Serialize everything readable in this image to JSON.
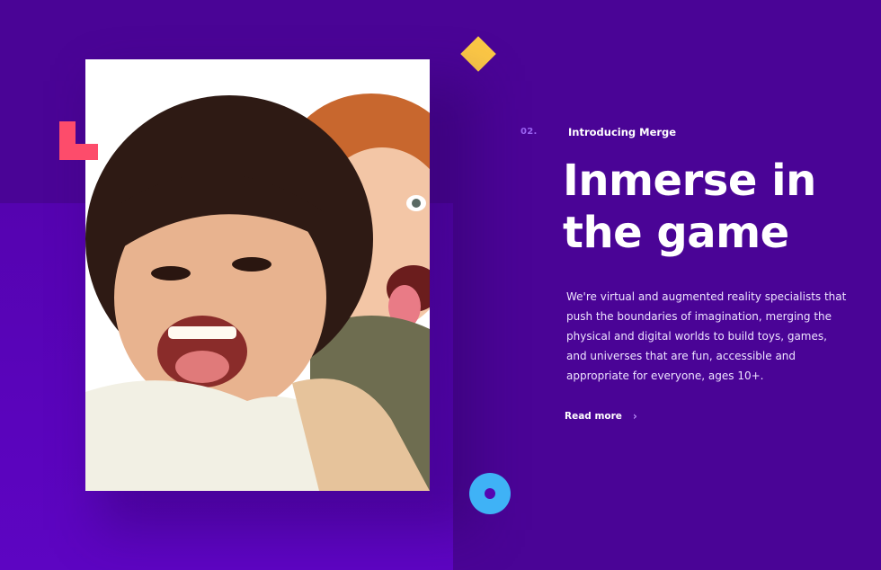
{
  "section": {
    "number": "02.",
    "eyebrow": "Introducing Merge",
    "headline": [
      "Inmerse in",
      "the game"
    ],
    "body": [
      "We're virtual and augmented reality specialists that",
      "push the boundaries of imagination, merging the",
      "physical and digital worlds to build toys, games,",
      "and universes that are fun, accessible and",
      "appropriate for everyone, ages 10+."
    ],
    "cta": {
      "label": "Read more",
      "icon": "chevron-right-icon"
    }
  },
  "photo": {
    "subject": "kids-laughing-photo"
  },
  "decorations": [
    {
      "name": "l-shape",
      "color": "#fd4c6b"
    },
    {
      "name": "diamond",
      "color": "#fcc845"
    },
    {
      "name": "ring",
      "color": "#3fb2f6"
    }
  ],
  "colors": {
    "background": "#4a0496",
    "panel": "#5503b0",
    "accent_number": "#9a63f2"
  }
}
